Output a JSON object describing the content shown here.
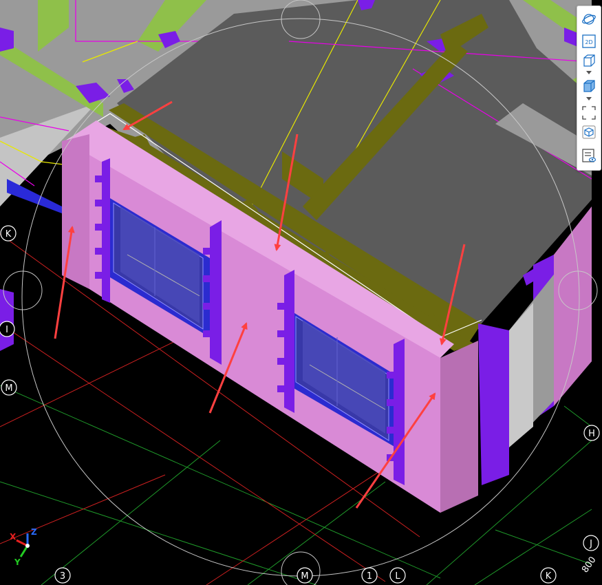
{
  "grid_axes": {
    "left": [
      "K",
      "I",
      "M"
    ],
    "right": [
      "H",
      "J"
    ],
    "bottom": [
      "3",
      "M",
      "1",
      "L",
      "K"
    ],
    "scale_label": "800"
  },
  "triad": {
    "x_label": "X",
    "y_label": "Y",
    "z_label": "Z"
  },
  "toolbar": {
    "buttons": [
      {
        "name": "orbit-button",
        "icon": "orbit-icon"
      },
      {
        "name": "2d-view-button",
        "icon": "2d-icon",
        "label": "2D"
      },
      {
        "name": "wireframe-view-button",
        "icon": "box-outline-icon"
      },
      {
        "name": "solid-view-button",
        "icon": "box-solid-icon"
      },
      {
        "name": "zoom-extents-button",
        "icon": "fit-screen-icon"
      },
      {
        "name": "3d-cube-button",
        "icon": "cube-icon"
      },
      {
        "name": "display-settings-button",
        "icon": "list-eye-icon"
      }
    ]
  },
  "colors": {
    "background": "#000000",
    "wall_pink": "#d98ad6",
    "column_violet": "#7a1ee6",
    "beam_olive": "#6b6a10",
    "slab_gray": "#5b5b5b",
    "window_blue": "#2b2bd0",
    "green_beam": "#8fc04a",
    "annotation_arrow": "#ff4040"
  }
}
